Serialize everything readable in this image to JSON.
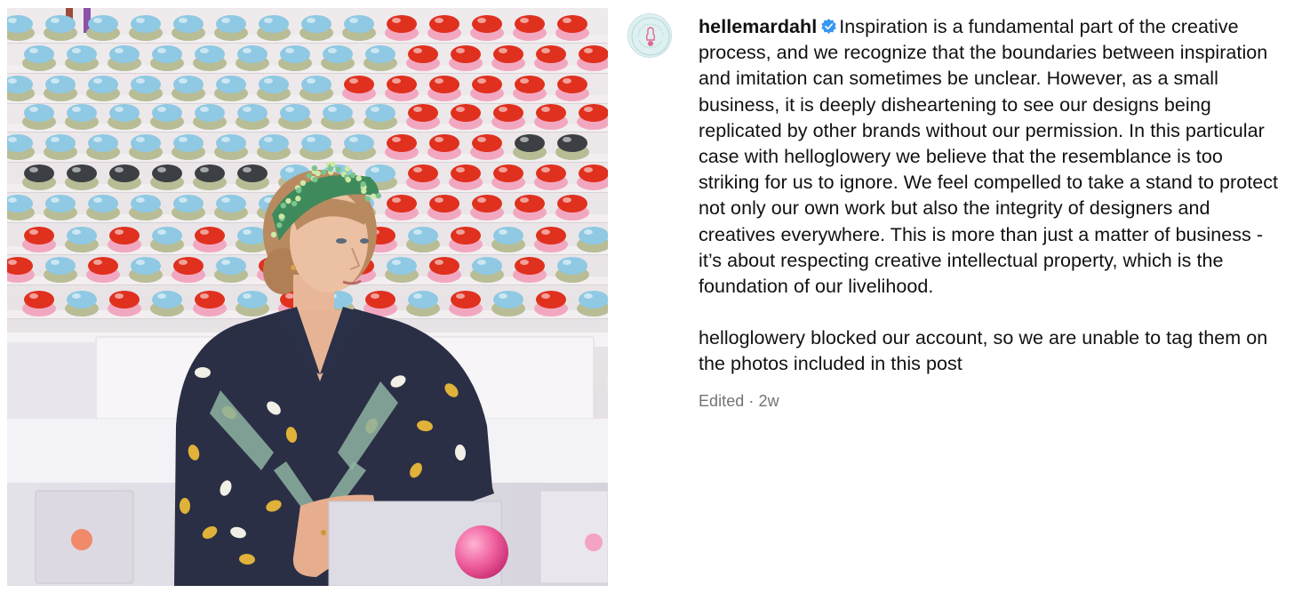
{
  "post": {
    "author": {
      "username": "hellemardahl",
      "verified": true,
      "avatar_icon": "brand-logo-avatar"
    },
    "caption_paragraphs": [
      "Inspiration is a fundamental part of the creative process, and we recognize that the boundaries between inspiration and imitation can sometimes be unclear. However, as a small business, it is deeply disheartening to see our designs being replicated by other brands without our permission. In this particular case with helloglowery we believe that the resemblance is too striking for us to ignore. We feel compelled to take a stand to protect not only our own work but also the integrity of designers and creatives everywhere. This is more than just a matter of business - it’s about respecting creative intellectual property, which is the foundation of our livelihood.",
      "helloglowery blocked our account, so we are unable to tag them on the photos included in this post"
    ],
    "meta": {
      "edited": "Edited",
      "separator": "·",
      "age": "2w"
    }
  },
  "colors": {
    "text": "#111111",
    "muted": "#737373",
    "verified_blue": "#3797f0",
    "glass_blue": "#8fc9e3",
    "glass_red": "#e0301e",
    "glass_pink": "#f2a7c0",
    "glass_sage": "#b8bd95",
    "glass_dark": "#3c3f44"
  }
}
